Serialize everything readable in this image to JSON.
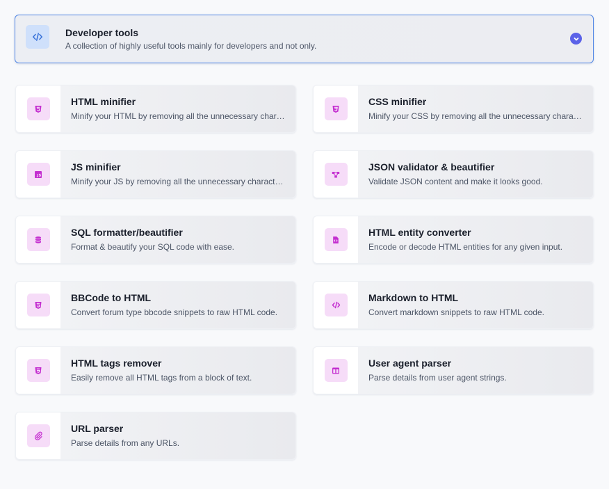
{
  "header": {
    "title": "Developer tools",
    "description": "A collection of highly useful tools mainly for developers and not only.",
    "icon": "code-icon",
    "accent_color": "#4f86e6",
    "chevron_icon": "chevron-down-icon"
  },
  "tools": [
    {
      "title": "HTML minifier",
      "description": "Minify your HTML by removing all the unnecessary characters.",
      "icon": "html5-icon"
    },
    {
      "title": "CSS minifier",
      "description": "Minify your CSS by removing all the unnecessary characters.",
      "icon": "css3-icon"
    },
    {
      "title": "JS minifier",
      "description": "Minify your JS by removing all the unnecessary characters.",
      "icon": "js-icon"
    },
    {
      "title": "JSON validator & beautifier",
      "description": "Validate JSON content and make it looks good.",
      "icon": "diagram-icon"
    },
    {
      "title": "SQL formatter/beautifier",
      "description": "Format & beautify your SQL code with ease.",
      "icon": "database-icon"
    },
    {
      "title": "HTML entity converter",
      "description": "Encode or decode HTML entities for any given input.",
      "icon": "file-code-icon"
    },
    {
      "title": "BBCode to HTML",
      "description": "Convert forum type bbcode snippets to raw HTML code.",
      "icon": "html5-icon"
    },
    {
      "title": "Markdown to HTML",
      "description": "Convert markdown snippets to raw HTML code.",
      "icon": "code-icon"
    },
    {
      "title": "HTML tags remover",
      "description": "Easily remove all HTML tags from a block of text.",
      "icon": "html5-icon"
    },
    {
      "title": "User agent parser",
      "description": "Parse details from user agent strings.",
      "icon": "columns-icon"
    },
    {
      "title": "URL parser",
      "description": "Parse details from any URLs.",
      "icon": "paperclip-icon"
    }
  ],
  "colors": {
    "tool_icon": "#c42fd0",
    "tool_icon_bg": "#f6dcf8",
    "header_icon": "#3b73d9",
    "header_icon_bg": "#cfe0fb"
  }
}
